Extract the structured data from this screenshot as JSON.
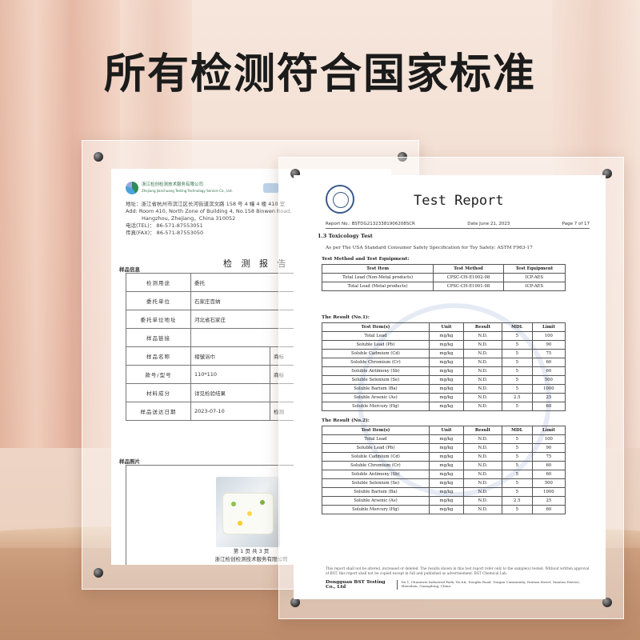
{
  "headline": "所有检测符合国家标准",
  "left_doc": {
    "company_cn": "浙江检创检测技术服务有限公司",
    "company_en": "Zhejiang Jianchuang Testing Technology Service Co., Ltd.",
    "address_cn": "地址：浙江省杭州市滨江区长河街道滨文路 158 号 4 幢 4 楼 410 室",
    "address_en_1": "Add: Room 410, North Zone of Building 4, No.158 Binwen Road,",
    "address_en_2": "Hangzhou, Zhejiang，China    310052",
    "tel": "电话(TEL)：  86-571-87553051",
    "fax": "传真(FAX)：  86-571-87553050",
    "title": "检 测 报 告",
    "section_info": "样品信息",
    "rows": [
      {
        "k": "检测用途",
        "v": "委托"
      },
      {
        "k": "委托单位",
        "v": "石家庄百纳"
      },
      {
        "k": "委托单位地址",
        "v": "河北省石家庄"
      },
      {
        "k": "样品链接",
        "v": ""
      },
      {
        "k": "样品名称",
        "v": "褶皱浴巾",
        "k2": "商标"
      },
      {
        "k": "款号/型号",
        "v": "110*110",
        "k2": "商标"
      },
      {
        "k": "材料成分",
        "v": "详见检验结果",
        "k2": ""
      },
      {
        "k": "样品送达日期",
        "v": "2023-07-10",
        "k2": "检测"
      }
    ],
    "section_photo": "样品照片",
    "page_no": "第 1 页 共 3 页",
    "footer": "浙江检创检测技术服务有限公司"
  },
  "right_doc": {
    "title": "Test Report",
    "report_no": "Report No.:  BSTDG21323381906208SCR",
    "date": "Date June 21, 2023",
    "page": "Page 7 of 17",
    "section": "1.3 Toxicology Test",
    "standard": "As per The USA Standard Consumer Safety Specification for Toy Safety: ASTM F963-17",
    "method_label": "Test Method and Test Equipment:",
    "method_headers": [
      "Test Item",
      "Test Method",
      "Test Equipment"
    ],
    "method_rows": [
      [
        "Total Lead (Non-Metal products)",
        "CPSC-CH-E1002-08",
        "ICP-AES"
      ],
      [
        "Total Lead (Metal products)",
        "CPSC-CH-E1001-08",
        "ICP-AES"
      ]
    ],
    "result1_label": "The Result (No.1):",
    "result2_label": "The Result (No.2):",
    "result_headers": [
      "Test Item(s)",
      "Unit",
      "Result",
      "MDL",
      "Limit"
    ],
    "result_rows": [
      [
        "Total Lead",
        "mg/kg",
        "N.D.",
        "5",
        "100"
      ],
      [
        "Soluble Lead (Pb)",
        "mg/kg",
        "N.D.",
        "5",
        "90"
      ],
      [
        "Soluble Cadmium (Cd)",
        "mg/kg",
        "N.D.",
        "5",
        "75"
      ],
      [
        "Soluble Chromium (Cr)",
        "mg/kg",
        "N.D.",
        "5",
        "60"
      ],
      [
        "Soluble Antimony (Sb)",
        "mg/kg",
        "N.D.",
        "5",
        "60"
      ],
      [
        "Soluble Selenium (Se)",
        "mg/kg",
        "N.D.",
        "5",
        "500"
      ],
      [
        "Soluble Barium (Ba)",
        "mg/kg",
        "N.D.",
        "5",
        "1000"
      ],
      [
        "Soluble Arsenic (As)",
        "mg/kg",
        "N.D.",
        "2.5",
        "25"
      ],
      [
        "Soluble Mercury (Hg)",
        "mg/kg",
        "N.D.",
        "5",
        "60"
      ]
    ],
    "disclaimer": "This report shall not be altered, increased or deleted. The results shown in this test report refer only to the sample(s) tested. Without written approval of BST, this report shall not be copied except in full and published as advertisement. BST Chemical Lab.",
    "company": "Dongguan BST Testing Co., Ltd",
    "company_address": "No.1, Chuanwei Industrial Park, No.6#, Donghu Road, Yongan Community, Yuntian Street, Xiantan District, Shenzhen, Guangdong, China."
  }
}
